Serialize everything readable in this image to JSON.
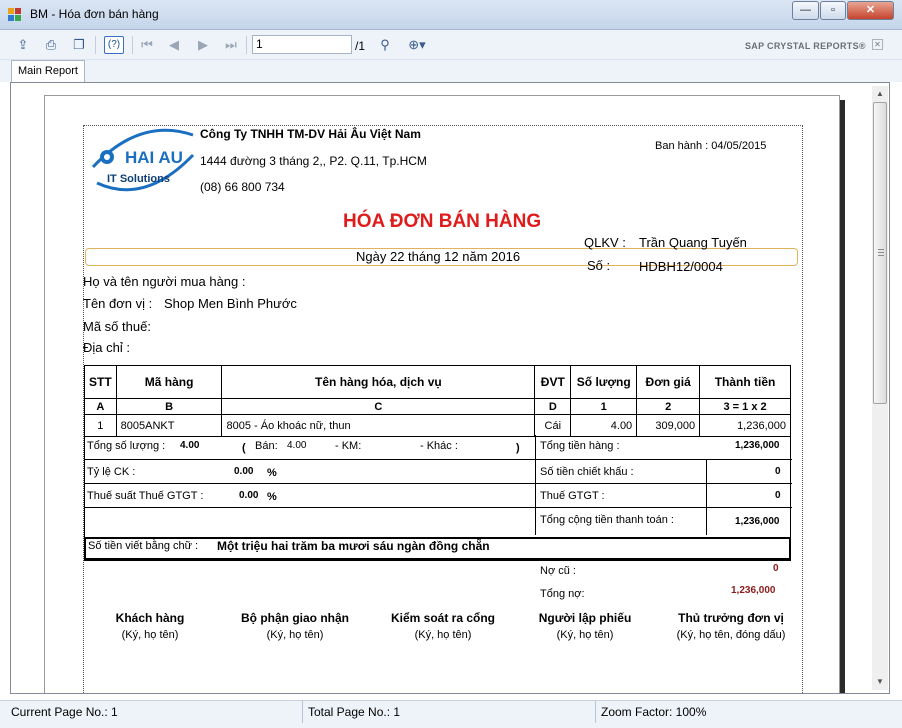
{
  "window": {
    "title": "BM - Hóa đơn bán hàng",
    "minimize": "—",
    "maximize": "▫",
    "close": "✕"
  },
  "toolbar": {
    "page_value": "1",
    "page_total": "/1",
    "help_label": "(?)",
    "brand": "SAP CRYSTAL REPORTS®",
    "brand_close": "✕"
  },
  "tabs": [
    {
      "label": "Main Report"
    }
  ],
  "logo": {
    "line1": "HAI AU",
    "line2": "IT Solutions"
  },
  "report": {
    "company": "Công Ty TNHH TM-DV Hải Âu Việt Nam",
    "address": "1444 đường 3 tháng 2,, P2. Q.11, Tp.HCM",
    "phone": "(08) 66 800 734",
    "issued": "Ban hành : 04/05/2015",
    "title": "HÓA ĐƠN BÁN HÀNG",
    "date": "Ngày 22 tháng 12 năm 2016",
    "qlkv_label": "QLKV :",
    "qlkv_value": "Trần Quang Tuyến",
    "so_label": "Số :",
    "so_value": "HDBH12/0004",
    "buyer_label": "Họ và tên người mua hàng :",
    "buyer_value": "",
    "unit_label": "Tên đơn vị :",
    "unit_value": "Shop Men Bình Phước",
    "tax_label": "Mã số thuế:",
    "tax_value": "",
    "address_label": "Địa chỉ :",
    "address_value": ""
  },
  "table": {
    "headers": [
      "STT",
      "Mã hàng",
      "Tên hàng hóa, dịch vụ",
      "ĐVT",
      "Số lượng",
      "Đơn giá",
      "Thành tiền"
    ],
    "codes": [
      "A",
      "B",
      "C",
      "D",
      "1",
      "2",
      "3 = 1 x 2"
    ],
    "rows": [
      {
        "stt": "1",
        "code": "8005ANKT",
        "name": "8005 - Áo khoác nữ, thun",
        "unit": "Cái",
        "qty": "4.00",
        "price": "309,000",
        "amount": "1,236,000"
      }
    ]
  },
  "summary": {
    "total_qty_label": "Tổng số lượng :",
    "total_qty_value": "4.00",
    "open_paren": "(",
    "ban_label": "Bán:",
    "ban_value": "4.00",
    "km_label": "- KM:",
    "khac_label": "- Khác :",
    "close_paren": ")",
    "total_goods_label": "Tổng tiền hàng :",
    "total_goods_value": "1,236,000",
    "discount_rate_label": "Tỷ lệ CK :",
    "discount_rate_value": "0.00",
    "pct1": "%",
    "discount_amount_label": "Số tiền chiết khấu :",
    "discount_amount_value": "0",
    "vat_rate_label": "Thuế suất Thuế GTGT :",
    "vat_rate_value": "0.00",
    "pct2": "%",
    "vat_label": "Thuế GTGT :",
    "vat_value": "0",
    "grand_total_label": "Tổng cộng tiền thanh toán :",
    "grand_total_value": "1,236,000",
    "words_label": "Số tiền viết bằng chữ :",
    "words_value": "Một triệu hai trăm ba mươi sáu ngàn đồng chẵn",
    "old_debt_label": "Nợ cũ :",
    "old_debt_value": "0",
    "total_debt_label": "Tổng nợ:",
    "total_debt_value": "1,236,000"
  },
  "signatures": [
    {
      "title": "Khách hàng",
      "sub": "(Ký, họ tên)"
    },
    {
      "title": "Bộ phận giao nhận",
      "sub": "(Ký, họ tên)"
    },
    {
      "title": "Kiểm soát ra cổng",
      "sub": "(Ký, họ tên)"
    },
    {
      "title": "Người lập phiếu",
      "sub": "(Ký, họ tên)"
    },
    {
      "title": "Thủ trưởng đơn vị",
      "sub": "(Ký, họ tên, đóng dấu)"
    }
  ],
  "status": {
    "current_page": "Current Page No.: 1",
    "total_page": "Total Page No.: 1",
    "zoom": "Zoom Factor: 100%"
  },
  "colors": {
    "title_red": "#e01b1b",
    "logo_blue": "#1b6fc1",
    "debt_red": "#8b1a1a"
  }
}
